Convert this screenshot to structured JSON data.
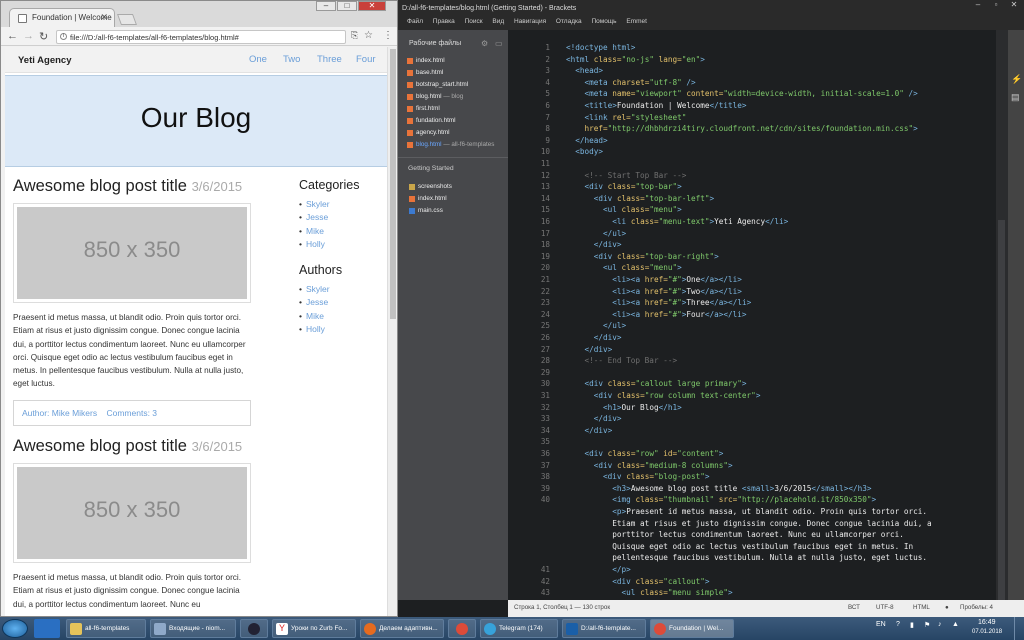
{
  "chrome": {
    "tab_title": "Foundation | Welcome",
    "address": "file:///D:/all-f6-templates/all-f6-templates/blog.html#"
  },
  "site": {
    "brand": "Yeti Agency",
    "menu": [
      "One",
      "Two",
      "Three",
      "Four"
    ],
    "callout_title": "Our Blog",
    "posts": [
      {
        "title": "Awesome blog post title",
        "date": "3/6/2015",
        "image_label": "850 x 350",
        "text": "Praesent id metus massa, ut blandit odio. Proin quis tortor orci. Etiam at risus et justo dignissim congue. Donec congue lacinia dui, a porttitor lectus condimentum laoreet. Nunc eu ullamcorper orci. Quisque eget odio ac lectus vestibulum faucibus eget in metus. In pellentesque faucibus vestibulum. Nulla at nulla justo, eget luctus.",
        "author": "Author: Mike Mikers",
        "comments": "Comments: 3"
      },
      {
        "title": "Awesome blog post title",
        "date": "3/6/2015",
        "image_label": "850 x 350",
        "text": "Praesent id metus massa, ut blandit odio. Proin quis tortor orci. Etiam at risus et justo dignissim congue. Donec congue lacinia dui, a porttitor lectus condimentum laoreet. Nunc eu"
      }
    ],
    "categories_title": "Categories",
    "categories": [
      "Skyler",
      "Jesse",
      "Mike",
      "Holly"
    ],
    "authors_title": "Authors",
    "authors": [
      "Skyler",
      "Jesse",
      "Mike",
      "Holly"
    ]
  },
  "brackets": {
    "title": "D:/all-f6-templates/blog.html (Getting Started) - Brackets",
    "menu": [
      "Файл",
      "Правка",
      "Поиск",
      "Вид",
      "Навигация",
      "Отладка",
      "Помощь",
      "Emmet"
    ],
    "working_files_title": "Рабочие файлы",
    "working_files": [
      {
        "name": "index.html",
        "note": ""
      },
      {
        "name": "base.html",
        "note": ""
      },
      {
        "name": "botstrap_start.html",
        "note": ""
      },
      {
        "name": "blog.html",
        "note": "— blog"
      },
      {
        "name": "first.html",
        "note": ""
      },
      {
        "name": "fundation.html",
        "note": ""
      },
      {
        "name": "agency.html",
        "note": ""
      },
      {
        "name": "blog.html",
        "note": "— all-f6-templates"
      }
    ],
    "project_title": "Getting Started",
    "project_files": [
      "screenshots",
      "index.html",
      "main.css"
    ],
    "status_left": "Строка 1, Столбец 1 — 130 строк",
    "status_right": [
      "ВСТ",
      "UTF-8",
      "HTML",
      "Пробелы: 4"
    ],
    "line_numbers": [
      "1",
      "2",
      "3",
      "4",
      "5",
      "6",
      "7",
      "8",
      "9",
      "10",
      "11",
      "12",
      "13",
      "14",
      "15",
      "16",
      "17",
      "18",
      "19",
      "20",
      "21",
      "22",
      "23",
      "24",
      "25",
      "26",
      "27",
      "28",
      "29",
      "30",
      "31",
      "32",
      "33",
      "34",
      "35",
      "36",
      "37",
      "38",
      "39",
      "40",
      "",
      "",
      "",
      "",
      "",
      "41",
      "42",
      "43"
    ],
    "code": [
      [
        [
          "t",
          "<!doctype html>"
        ]
      ],
      [
        [
          "t",
          "<html "
        ],
        [
          "a",
          "class="
        ],
        [
          "s",
          "\"no-js\""
        ],
        [
          "a",
          " lang="
        ],
        [
          "s",
          "\"en\""
        ],
        [
          "t",
          ">"
        ]
      ],
      [
        [
          "tx",
          "  "
        ],
        [
          "t",
          "<head>"
        ]
      ],
      [
        [
          "tx",
          "    "
        ],
        [
          "t",
          "<meta "
        ],
        [
          "a",
          "charset="
        ],
        [
          "s",
          "\"utf-8\""
        ],
        [
          "t",
          " />"
        ]
      ],
      [
        [
          "tx",
          "    "
        ],
        [
          "t",
          "<meta "
        ],
        [
          "a",
          "name="
        ],
        [
          "s",
          "\"viewport\""
        ],
        [
          "a",
          " content="
        ],
        [
          "s",
          "\"width=device-width, initial-scale=1.0\""
        ],
        [
          "t",
          " />"
        ]
      ],
      [
        [
          "tx",
          "    "
        ],
        [
          "t",
          "<title>"
        ],
        [
          "tx",
          "Foundation | Welcome"
        ],
        [
          "t",
          "</title>"
        ]
      ],
      [
        [
          "tx",
          "    "
        ],
        [
          "t",
          "<link "
        ],
        [
          "a",
          "rel="
        ],
        [
          "s",
          "\"stylesheet\""
        ]
      ],
      [
        [
          "tx",
          "    "
        ],
        [
          "a",
          "href="
        ],
        [
          "s",
          "\"http://dhbhdrzi4tiry.cloudfront.net/cdn/sites/foundation.min.css\""
        ],
        [
          "t",
          ">"
        ]
      ],
      [
        [
          "tx",
          "  "
        ],
        [
          "t",
          "</head>"
        ]
      ],
      [
        [
          "tx",
          "  "
        ],
        [
          "t",
          "<body>"
        ]
      ],
      [],
      [
        [
          "tx",
          "    "
        ],
        [
          "c",
          "<!-- Start Top Bar -->"
        ]
      ],
      [
        [
          "tx",
          "    "
        ],
        [
          "t",
          "<div "
        ],
        [
          "a",
          "class="
        ],
        [
          "s",
          "\"top-bar\""
        ],
        [
          "t",
          ">"
        ]
      ],
      [
        [
          "tx",
          "      "
        ],
        [
          "t",
          "<div "
        ],
        [
          "a",
          "class="
        ],
        [
          "s",
          "\"top-bar-left\""
        ],
        [
          "t",
          ">"
        ]
      ],
      [
        [
          "tx",
          "        "
        ],
        [
          "t",
          "<ul "
        ],
        [
          "a",
          "class="
        ],
        [
          "s",
          "\"menu\""
        ],
        [
          "t",
          ">"
        ]
      ],
      [
        [
          "tx",
          "          "
        ],
        [
          "t",
          "<li "
        ],
        [
          "a",
          "class="
        ],
        [
          "s",
          "\"menu-text\""
        ],
        [
          "t",
          ">"
        ],
        [
          "tx",
          "Yeti Agency"
        ],
        [
          "t",
          "</li>"
        ]
      ],
      [
        [
          "tx",
          "        "
        ],
        [
          "t",
          "</ul>"
        ]
      ],
      [
        [
          "tx",
          "      "
        ],
        [
          "t",
          "</div>"
        ]
      ],
      [
        [
          "tx",
          "      "
        ],
        [
          "t",
          "<div "
        ],
        [
          "a",
          "class="
        ],
        [
          "s",
          "\"top-bar-right\""
        ],
        [
          "t",
          ">"
        ]
      ],
      [
        [
          "tx",
          "        "
        ],
        [
          "t",
          "<ul "
        ],
        [
          "a",
          "class="
        ],
        [
          "s",
          "\"menu\""
        ],
        [
          "t",
          ">"
        ]
      ],
      [
        [
          "tx",
          "          "
        ],
        [
          "t",
          "<li><a "
        ],
        [
          "a",
          "href="
        ],
        [
          "s",
          "\"#\""
        ],
        [
          "t",
          ">"
        ],
        [
          "tx",
          "One"
        ],
        [
          "t",
          "</a></li>"
        ]
      ],
      [
        [
          "tx",
          "          "
        ],
        [
          "t",
          "<li><a "
        ],
        [
          "a",
          "href="
        ],
        [
          "s",
          "\"#\""
        ],
        [
          "t",
          ">"
        ],
        [
          "tx",
          "Two"
        ],
        [
          "t",
          "</a></li>"
        ]
      ],
      [
        [
          "tx",
          "          "
        ],
        [
          "t",
          "<li><a "
        ],
        [
          "a",
          "href="
        ],
        [
          "s",
          "\"#\""
        ],
        [
          "t",
          ">"
        ],
        [
          "tx",
          "Three"
        ],
        [
          "t",
          "</a></li>"
        ]
      ],
      [
        [
          "tx",
          "          "
        ],
        [
          "t",
          "<li><a "
        ],
        [
          "a",
          "href="
        ],
        [
          "s",
          "\"#\""
        ],
        [
          "t",
          ">"
        ],
        [
          "tx",
          "Four"
        ],
        [
          "t",
          "</a></li>"
        ]
      ],
      [
        [
          "tx",
          "        "
        ],
        [
          "t",
          "</ul>"
        ]
      ],
      [
        [
          "tx",
          "      "
        ],
        [
          "t",
          "</div>"
        ]
      ],
      [
        [
          "tx",
          "    "
        ],
        [
          "t",
          "</div>"
        ]
      ],
      [
        [
          "tx",
          "    "
        ],
        [
          "c",
          "<!-- End Top Bar -->"
        ]
      ],
      [],
      [
        [
          "tx",
          "    "
        ],
        [
          "t",
          "<div "
        ],
        [
          "a",
          "class="
        ],
        [
          "s",
          "\"callout large primary\""
        ],
        [
          "t",
          ">"
        ]
      ],
      [
        [
          "tx",
          "      "
        ],
        [
          "t",
          "<div "
        ],
        [
          "a",
          "class="
        ],
        [
          "s",
          "\"row column text-center\""
        ],
        [
          "t",
          ">"
        ]
      ],
      [
        [
          "tx",
          "        "
        ],
        [
          "t",
          "<h1>"
        ],
        [
          "tx",
          "Our Blog"
        ],
        [
          "t",
          "</h1>"
        ]
      ],
      [
        [
          "tx",
          "      "
        ],
        [
          "t",
          "</div>"
        ]
      ],
      [
        [
          "tx",
          "    "
        ],
        [
          "t",
          "</div>"
        ]
      ],
      [],
      [
        [
          "tx",
          "    "
        ],
        [
          "t",
          "<div "
        ],
        [
          "a",
          "class="
        ],
        [
          "s",
          "\"row\""
        ],
        [
          "a",
          " id="
        ],
        [
          "s",
          "\"content\""
        ],
        [
          "t",
          ">"
        ]
      ],
      [
        [
          "tx",
          "      "
        ],
        [
          "t",
          "<div "
        ],
        [
          "a",
          "class="
        ],
        [
          "s",
          "\"medium-8 columns\""
        ],
        [
          "t",
          ">"
        ]
      ],
      [
        [
          "tx",
          "        "
        ],
        [
          "t",
          "<div "
        ],
        [
          "a",
          "class="
        ],
        [
          "s",
          "\"blog-post\""
        ],
        [
          "t",
          ">"
        ]
      ],
      [
        [
          "tx",
          "          "
        ],
        [
          "t",
          "<h3>"
        ],
        [
          "tx",
          "Awesome blog post title "
        ],
        [
          "t",
          "<small>"
        ],
        [
          "tx",
          "3/6/2015"
        ],
        [
          "t",
          "</small></h3>"
        ]
      ],
      [
        [
          "tx",
          "          "
        ],
        [
          "t",
          "<img "
        ],
        [
          "a",
          "class="
        ],
        [
          "s",
          "\"thumbnail\""
        ],
        [
          "a",
          " src="
        ],
        [
          "s",
          "\"http://placehold.it/850x350\""
        ],
        [
          "t",
          ">"
        ]
      ],
      [
        [
          "tx",
          "          "
        ],
        [
          "t",
          "<p>"
        ],
        [
          "tx",
          "Praesent id metus massa, ut blandit odio. Proin quis tortor orci."
        ]
      ],
      [
        [
          "tx",
          "          Etiam at risus et justo dignissim congue. Donec congue lacinia dui, a"
        ]
      ],
      [
        [
          "tx",
          "          porttitor lectus condimentum laoreet. Nunc eu ullamcorper orci."
        ]
      ],
      [
        [
          "tx",
          "          Quisque eget odio ac lectus vestibulum faucibus eget in metus. In"
        ]
      ],
      [
        [
          "tx",
          "          pellentesque faucibus vestibulum. Nulla at nulla justo, eget luctus."
        ]
      ],
      [
        [
          "tx",
          "          "
        ],
        [
          "t",
          "</p>"
        ]
      ],
      [
        [
          "tx",
          "          "
        ],
        [
          "t",
          "<div "
        ],
        [
          "a",
          "class="
        ],
        [
          "s",
          "\"callout\""
        ],
        [
          "t",
          ">"
        ]
      ],
      [
        [
          "tx",
          "            "
        ],
        [
          "t",
          "<ul "
        ],
        [
          "a",
          "class="
        ],
        [
          "s",
          "\"menu simple\""
        ],
        [
          "t",
          ">"
        ]
      ],
      [
        [
          "tx",
          "              "
        ],
        [
          "t",
          "<li><a "
        ],
        [
          "a",
          "href="
        ],
        [
          "s",
          "\"#\""
        ],
        [
          "t",
          ">"
        ],
        [
          "tx",
          "Author: Mike Mikers"
        ],
        [
          "t",
          "</a></li>"
        ]
      ],
      [
        [
          "tx",
          "              "
        ],
        [
          "t",
          "<li><a "
        ],
        [
          "a",
          "href="
        ],
        [
          "s",
          "\"#\""
        ],
        [
          "t",
          ">"
        ],
        [
          "tx",
          "Comments: 3"
        ],
        [
          "t",
          "</a></li>"
        ]
      ]
    ]
  },
  "taskbar": {
    "buttons": [
      "all-f6-templates",
      "Входящие - niom...",
      "",
      "Уроки по Zurb Fo...",
      "Делаем адаптивн...",
      "",
      "Telegram (174)",
      "D:/all-f6-template...",
      "Foundation | Wel..."
    ],
    "lang": "EN",
    "time": "16:49",
    "date": "07.01.2018"
  }
}
